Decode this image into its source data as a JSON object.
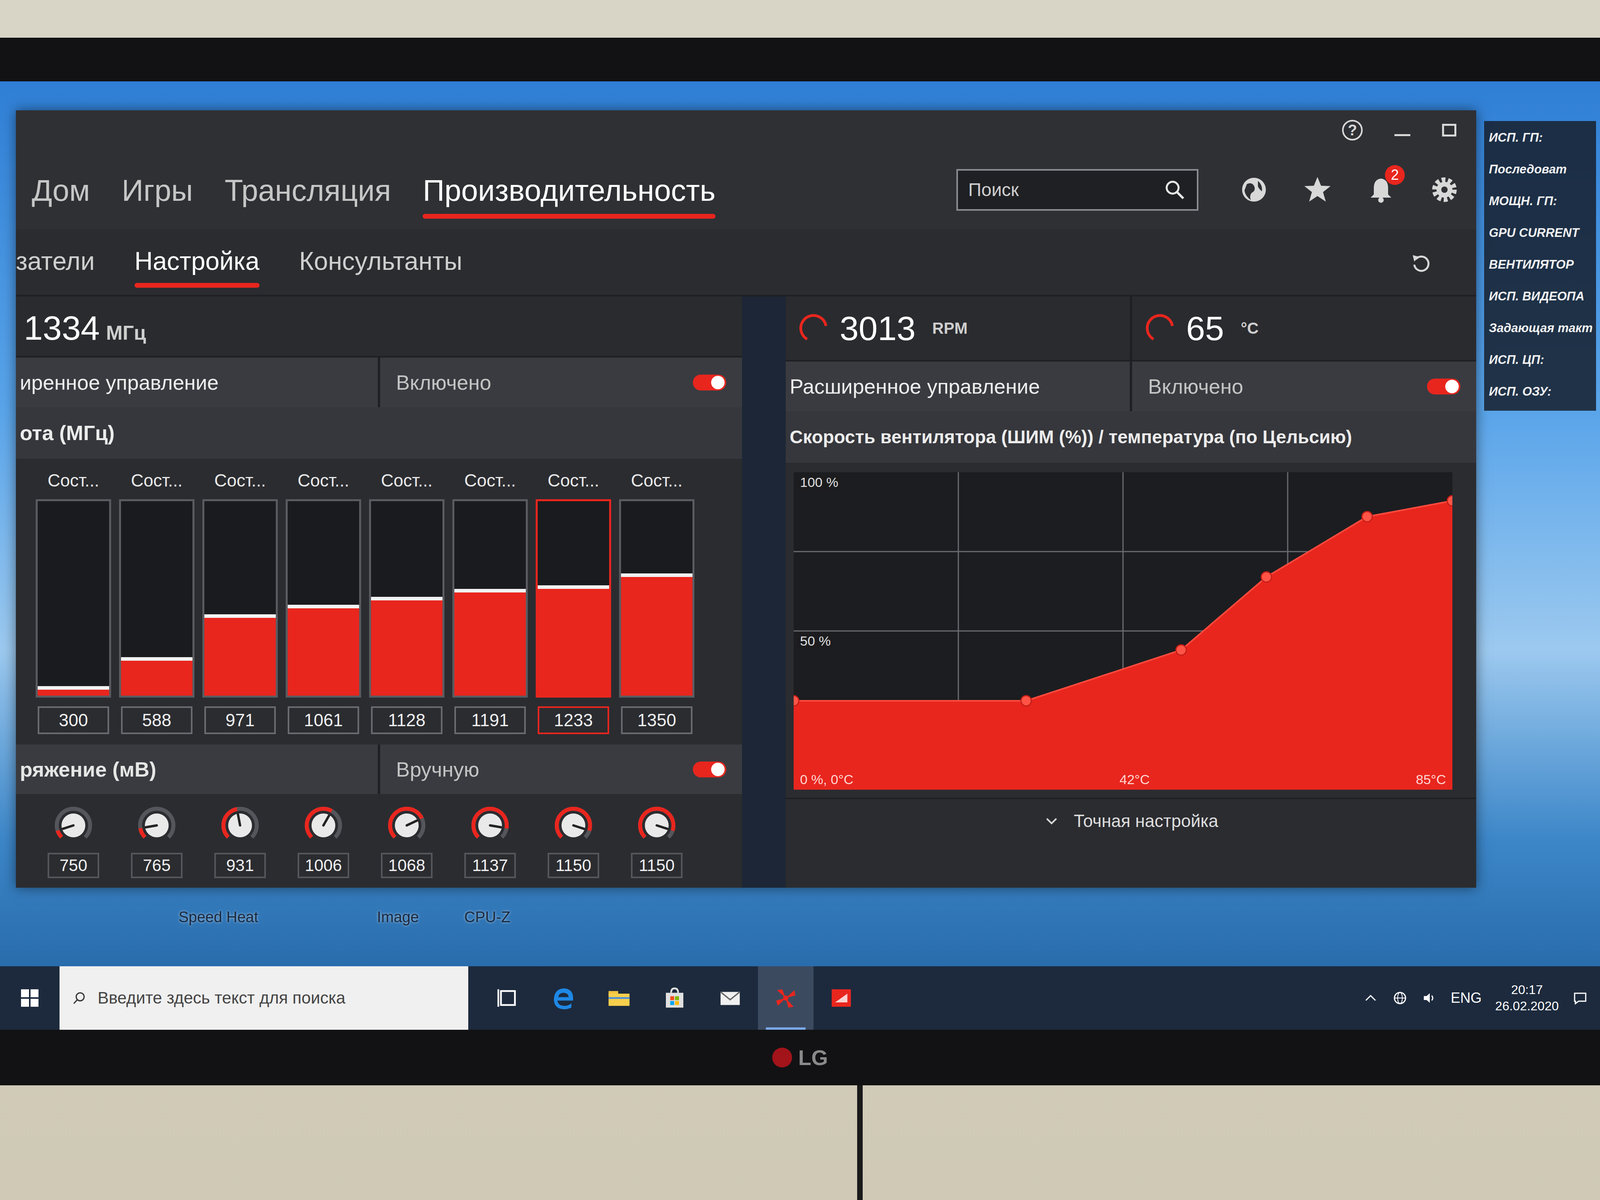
{
  "app": {
    "help": "?"
  },
  "nav": {
    "tabs": [
      {
        "label": "Дом",
        "selected": false
      },
      {
        "label": "Игры",
        "selected": false
      },
      {
        "label": "Трансляция",
        "selected": false
      },
      {
        "label": "Производительность",
        "selected": true
      }
    ],
    "search": {
      "placeholder": "Поиск"
    },
    "notifications": {
      "count": "2"
    }
  },
  "subtabs": [
    {
      "label": "затели",
      "selected": false
    },
    {
      "label": "Настройка",
      "selected": true
    },
    {
      "label": "Консультанты",
      "selected": false
    }
  ],
  "gpu": {
    "reading": "1334",
    "unit": "МГц",
    "level": 0.75,
    "advanced": {
      "label": "иренное управление",
      "value": "Включено",
      "on": true
    },
    "freq_header": "ота (МГц)",
    "states": [
      {
        "label": "Сост...",
        "value": "300",
        "level": 0.03,
        "selected": false
      },
      {
        "label": "Сост...",
        "value": "588",
        "level": 0.18,
        "selected": false
      },
      {
        "label": "Сост...",
        "value": "971",
        "level": 0.4,
        "selected": false
      },
      {
        "label": "Сост...",
        "value": "1061",
        "level": 0.45,
        "selected": false
      },
      {
        "label": "Сост...",
        "value": "1128",
        "level": 0.49,
        "selected": false
      },
      {
        "label": "Сост...",
        "value": "1191",
        "level": 0.53,
        "selected": false
      },
      {
        "label": "Сост...",
        "value": "1233",
        "level": 0.55,
        "selected": true
      },
      {
        "label": "Сост...",
        "value": "1350",
        "level": 0.61,
        "selected": false
      }
    ],
    "voltage": {
      "label": "ряжение (мВ)",
      "value": "Вручную",
      "on": true,
      "knobs": [
        {
          "value": "750",
          "level": 0.1
        },
        {
          "value": "765",
          "level": 0.13
        },
        {
          "value": "931",
          "level": 0.46
        },
        {
          "value": "1006",
          "level": 0.61
        },
        {
          "value": "1068",
          "level": 0.74
        },
        {
          "value": "1137",
          "level": 0.87
        },
        {
          "value": "1150",
          "level": 0.9
        },
        {
          "value": "1150",
          "level": 0.9
        }
      ]
    }
  },
  "fan": {
    "rpm": "3013",
    "rpm_unit": "RPM",
    "rpm_level": 0.75,
    "temp": "65",
    "temp_unit": "°C",
    "temp_level": 0.75,
    "advanced": {
      "label": "Расширенное управление",
      "value": "Включено",
      "on": true
    },
    "chart": {
      "title": "Скорость вентилятора (ШИМ (%)) / температура (по Цельсию)",
      "y_labels": [
        "100 %",
        "50 %"
      ],
      "x_labels": [
        "0 %, 0°C",
        "42°C",
        "85°C"
      ],
      "temps": [
        0,
        30,
        50,
        61,
        74,
        85
      ],
      "speeds": [
        28,
        28,
        44,
        67,
        86,
        91
      ]
    },
    "fine_tune": "Точная настройка"
  },
  "overlay": {
    "items": [
      "ИСП. ГП:",
      "Последоват",
      "МОЩН. ГП:",
      "GPU CURRENT",
      "ВЕНТИЛЯТОР",
      "ИСП. ВИДЕОПА",
      "Задающая такт",
      "ИСП. ЦП:",
      "ИСП. ОЗУ:"
    ]
  },
  "desktop_icons": [
    {
      "label": "Speed Heat"
    },
    {
      "label": "Image"
    },
    {
      "label": "CPU-Z"
    }
  ],
  "taskbar": {
    "search_placeholder": "Введите здесь текст для поиска",
    "apps": [
      {
        "kind": "taskview",
        "active": false
      },
      {
        "kind": "edge",
        "active": false
      },
      {
        "kind": "folder",
        "active": false
      },
      {
        "kind": "store",
        "active": false
      },
      {
        "kind": "mail",
        "active": false
      },
      {
        "kind": "fan",
        "active": true
      },
      {
        "kind": "radeon",
        "active": false
      }
    ],
    "language": "ENG",
    "time": "20:17",
    "date": "26.02.2020"
  },
  "monitor": {
    "brand": "LG"
  }
}
